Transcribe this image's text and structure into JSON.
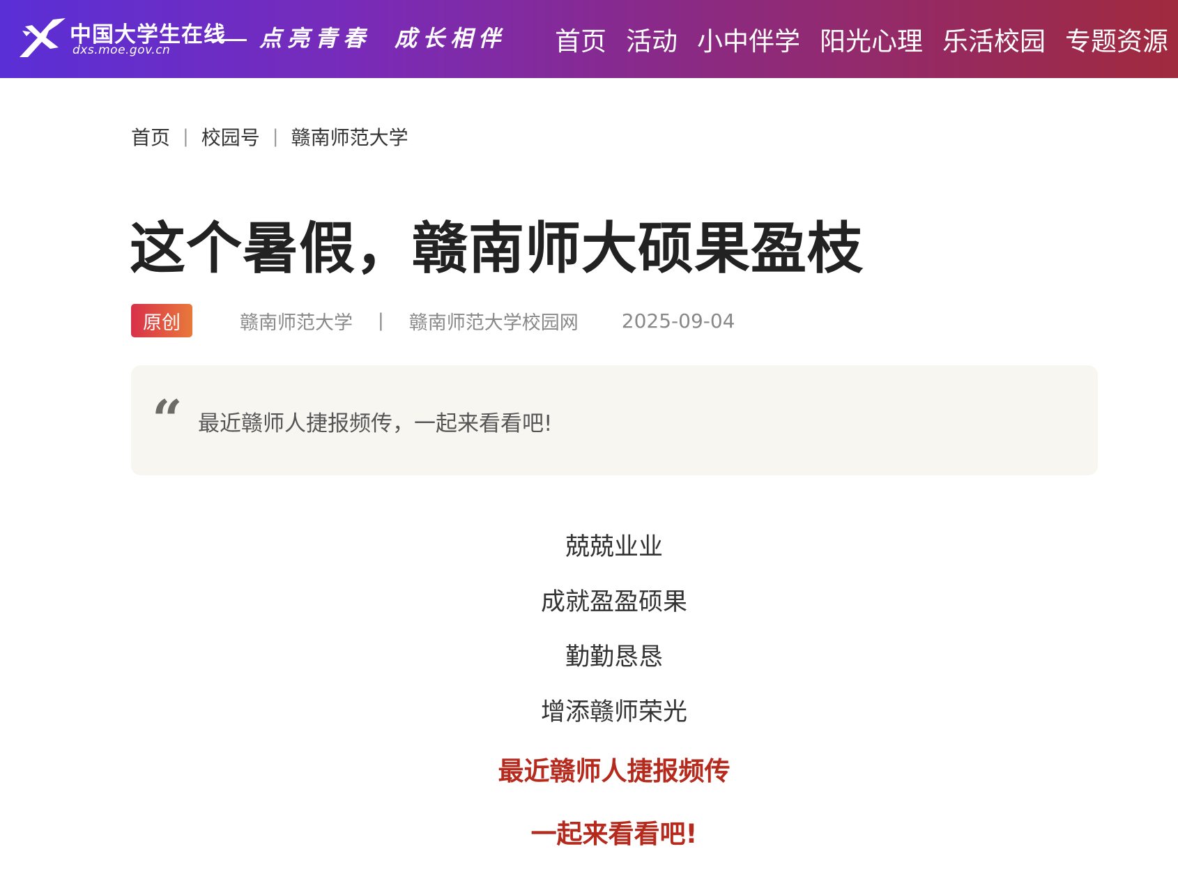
{
  "header": {
    "logo_name": "中国大学生在线",
    "logo_url": "dxs.moe.gov.cn",
    "slogan_part1": "点亮青春",
    "slogan_part2": "成长相伴",
    "nav": [
      {
        "label": "首页"
      },
      {
        "label": "活动"
      },
      {
        "label": "小中伴学"
      },
      {
        "label": "阳光心理"
      },
      {
        "label": "乐活校园"
      },
      {
        "label": "专题资源"
      }
    ]
  },
  "breadcrumb": {
    "items": [
      "首页",
      "校园号",
      "赣南师范大学"
    ],
    "separator": "|"
  },
  "article": {
    "title": "这个暑假，赣南师大硕果盈枝",
    "badge": "原创",
    "source": "赣南师范大学",
    "meta_separator": "|",
    "site": "赣南师范大学校园网",
    "date": "2025-09-04",
    "quote_mark": "“",
    "summary": "最近赣师人捷报频传，一起来看看吧!",
    "body_lines": [
      "兢兢业业",
      "成就盈盈硕果",
      "勤勤恳恳",
      "增添赣师荣光"
    ],
    "highlight_lines": [
      "最近赣师人捷报频传",
      "一起来看看吧!"
    ]
  },
  "colors": {
    "header_gradient_start": "#5a2fd6",
    "header_gradient_end": "#a02a3e",
    "badge_start": "#d8304a",
    "badge_end": "#e8793a",
    "highlight_text": "#b52a1c",
    "quote_background": "#f8f6f1"
  }
}
